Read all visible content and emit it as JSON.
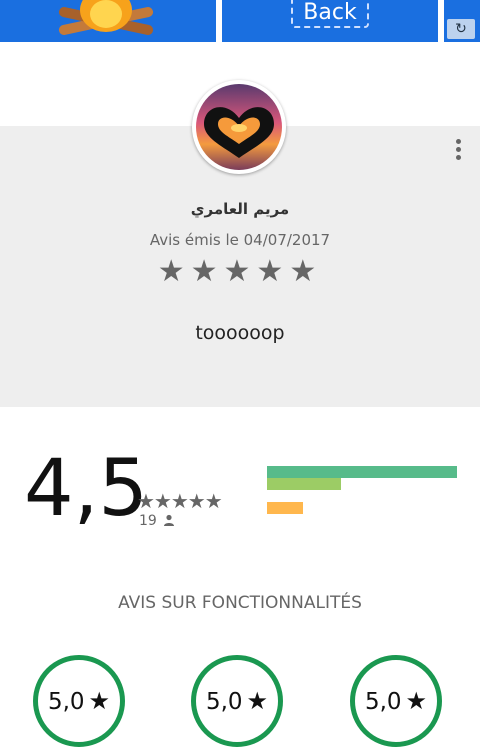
{
  "top_strip": {
    "back_label": "Back",
    "reload_icon": "reload-icon",
    "fire_icon": "campfire-icon"
  },
  "review": {
    "reviewer_name": "مريم العامري",
    "date_text": "Avis émis le 04/07/2017",
    "stars_text": "★★★★★",
    "stars_value": 5,
    "text": "toooooop",
    "menu_icon": "more-vertical-icon",
    "avatar_icon": "heart-hands-avatar"
  },
  "summary": {
    "average": "4,5",
    "stars_text": "★★★★★",
    "count": "19",
    "person_icon": "person-icon",
    "distribution": [
      {
        "stars": 5,
        "fraction": 1.0,
        "color": "#57bb8a"
      },
      {
        "stars": 4,
        "fraction": 0.39,
        "color": "#9ccc65"
      },
      {
        "stars": 3,
        "fraction": 0.0,
        "color": "#ffcf3f"
      },
      {
        "stars": 2,
        "fraction": 0.19,
        "color": "#ffb74d"
      },
      {
        "stars": 1,
        "fraction": 0.0,
        "color": "#f88e6e"
      }
    ]
  },
  "features": {
    "title": "AVIS SUR FONCTIONNALITÉS",
    "items": [
      {
        "value": "5,0",
        "star": "★"
      },
      {
        "value": "5,0",
        "star": "★"
      },
      {
        "value": "5,0",
        "star": "★"
      }
    ],
    "ring_color": "#1a9850"
  }
}
